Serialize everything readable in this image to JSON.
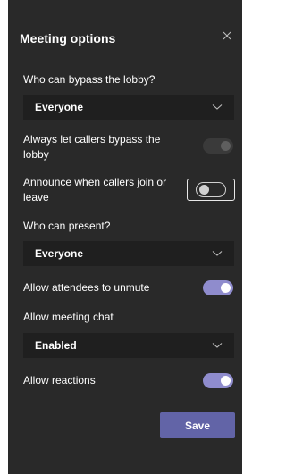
{
  "dialog": {
    "title": "Meeting options",
    "close_icon": "close-icon"
  },
  "options": {
    "bypass_lobby": {
      "label": "Who can bypass the lobby?",
      "selected": "Everyone"
    },
    "callers_bypass": {
      "label": "Always let callers bypass the lobby",
      "state": "on-disabled"
    },
    "announce_callers": {
      "label": "Announce when callers join or leave",
      "state": "off",
      "focused": true
    },
    "who_can_present": {
      "label": "Who can present?",
      "selected": "Everyone"
    },
    "allow_unmute": {
      "label": "Allow attendees to unmute",
      "state": "on"
    },
    "meeting_chat": {
      "label": "Allow meeting chat",
      "selected": "Enabled"
    },
    "allow_reactions": {
      "label": "Allow reactions",
      "state": "on"
    }
  },
  "footer": {
    "save_label": "Save"
  },
  "colors": {
    "panel_bg": "#292929",
    "select_bg": "#1f1f1f",
    "toggle_on": "#8f8ccd",
    "accent": "#6264a7",
    "text": "#ffffff"
  }
}
